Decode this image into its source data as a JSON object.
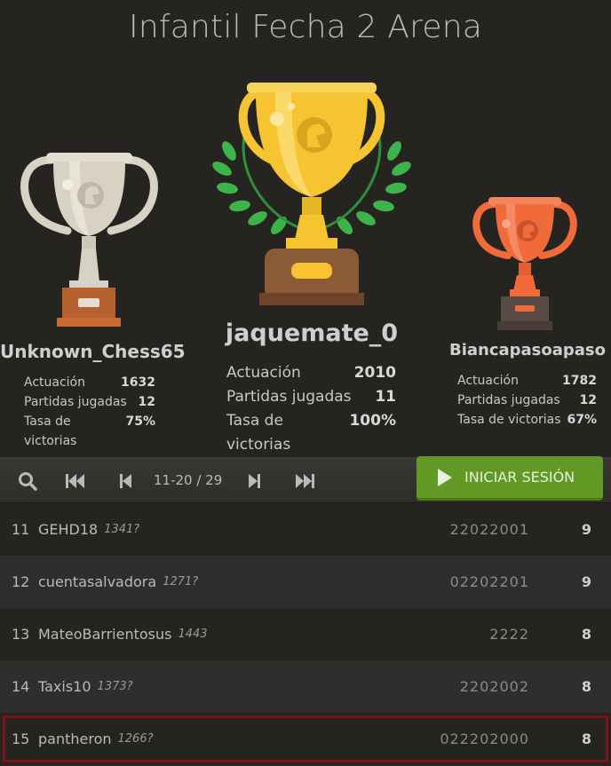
{
  "title": "Infantil Fecha 2 Arena",
  "podium": {
    "first": {
      "name": "jaquemate_0",
      "stats": [
        {
          "label": "Actuación",
          "value": "2010"
        },
        {
          "label": "Partidas jugadas",
          "value": "11"
        },
        {
          "label": "Tasa de victorias",
          "value": "100%"
        }
      ]
    },
    "second": {
      "name": "Unknown_Chess65",
      "stats": [
        {
          "label": "Actuación",
          "value": "1632"
        },
        {
          "label": "Partidas jugadas",
          "value": "12"
        },
        {
          "label": "Tasa de victorias",
          "value": "75%"
        }
      ]
    },
    "third": {
      "name": "Biancapasoapaso",
      "stats": [
        {
          "label": "Actuación",
          "value": "1782"
        },
        {
          "label": "Partidas jugadas",
          "value": "12"
        },
        {
          "label": "Tasa de victorias",
          "value": "67%"
        }
      ]
    }
  },
  "toolbar": {
    "page_info": "11-20 / 29",
    "login_label": "INICIAR SESIÓN"
  },
  "standings": [
    {
      "rank": "11",
      "name": "GEHD18",
      "rating": "1341?",
      "sheet": "22022001",
      "score": "9"
    },
    {
      "rank": "12",
      "name": "cuentasalvadora",
      "rating": "1271?",
      "sheet": "02202201",
      "score": "9"
    },
    {
      "rank": "13",
      "name": "MateoBarrientosus",
      "rating": "1443",
      "sheet": "2222",
      "score": "8"
    },
    {
      "rank": "14",
      "name": "Taxis10",
      "rating": "1373?",
      "sheet": "2202002",
      "score": "8"
    },
    {
      "rank": "15",
      "name": "pantheron",
      "rating": "1266?",
      "sheet": "022202000",
      "score": "8"
    }
  ],
  "colors": {
    "background": "#262421",
    "accent_green": "#629924",
    "gold": "#f5c430",
    "silver": "#d8d2c4",
    "bronze": "#f06a3a",
    "highlight_border": "#7a1418"
  }
}
